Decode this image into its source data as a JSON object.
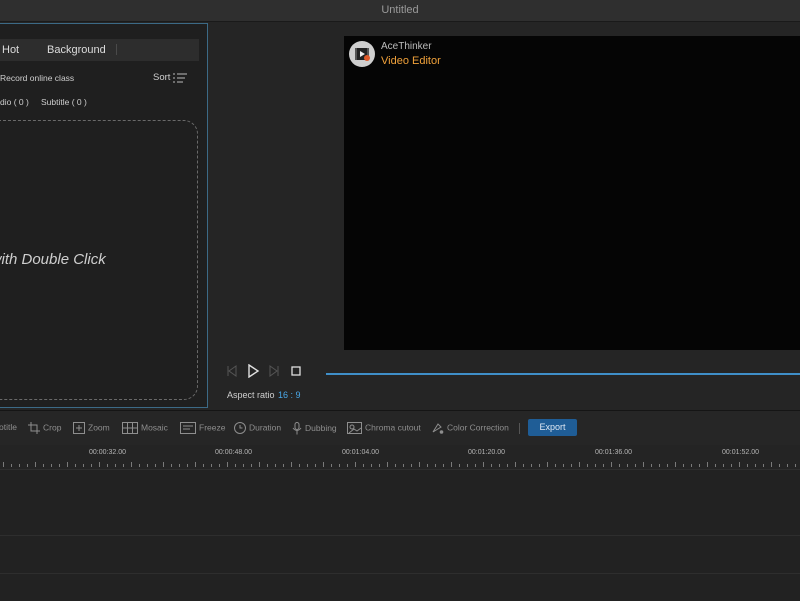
{
  "window": {
    "title": "Untitled"
  },
  "library": {
    "tabs": [
      {
        "label": "Hot"
      },
      {
        "label": "Background"
      }
    ],
    "record_label": "Record online class",
    "sort_label": "Sort",
    "filters": [
      {
        "label": "dio ( 0 )"
      },
      {
        "label": "Subtitle ( 0 )"
      }
    ],
    "dropzone_text": "s with Double Click"
  },
  "preview": {
    "brand_name": "AceThinker",
    "brand_sub": "Video Editor",
    "aspect_label": "Aspect ratio",
    "aspect_value": "16 : 9"
  },
  "toolbar": {
    "items": [
      {
        "label": "otitle",
        "icon": "text-icon"
      },
      {
        "label": "Crop",
        "icon": "crop-icon"
      },
      {
        "label": "Zoom",
        "icon": "zoom-icon"
      },
      {
        "label": "Mosaic",
        "icon": "mosaic-icon"
      },
      {
        "label": "Freeze",
        "icon": "freeze-icon"
      },
      {
        "label": "Duration",
        "icon": "clock-icon"
      },
      {
        "label": "Dubbing",
        "icon": "microphone-icon"
      },
      {
        "label": "Chroma cutout",
        "icon": "chroma-icon"
      },
      {
        "label": "Color Correction",
        "icon": "color-icon"
      }
    ],
    "export_label": "Export"
  },
  "timeline": {
    "marks": [
      "00:00:32.00",
      "00:00:48.00",
      "00:01:04.00",
      "00:01:20.00",
      "00:01:36.00",
      "00:01:52.00"
    ]
  },
  "colors": {
    "accent": "#3f8fc9",
    "brand": "#f0a13a",
    "export_bg": "#1f5d96"
  }
}
